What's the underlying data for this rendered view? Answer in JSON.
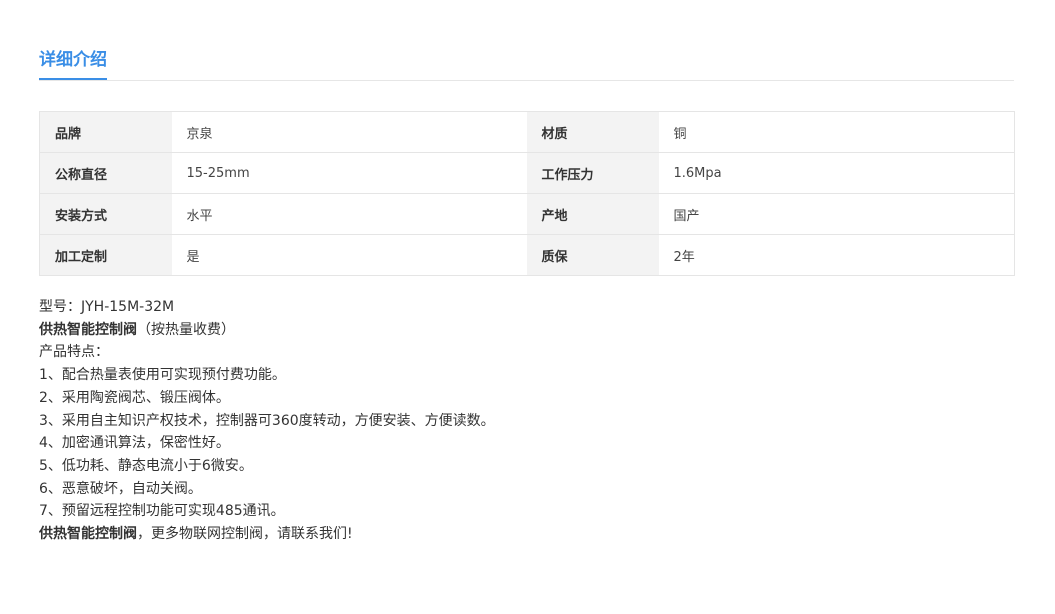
{
  "section": {
    "title": "详细介绍"
  },
  "specs": [
    {
      "k1": "品牌",
      "v1": "京泉",
      "k2": "材质",
      "v2": "铜"
    },
    {
      "k1": "公称直径",
      "v1": "15-25mm",
      "k2": "工作压力",
      "v2": "1.6Mpa"
    },
    {
      "k1": "安装方式",
      "v1": "水平",
      "k2": "产地",
      "v2": "国产"
    },
    {
      "k1": "加工定制",
      "v1": "是",
      "k2": "质保",
      "v2": "2年"
    }
  ],
  "description": {
    "model": "型号：JYH-15M-32M",
    "product_bold": "供热智能控制阀",
    "product_suffix": "（按热量收费）",
    "features_label": "产品特点：",
    "features": [
      "1、配合热量表使用可实现预付费功能。",
      "2、采用陶瓷阀芯、锻压阀体。",
      "3、采用自主知识产权技术，控制器可360度转动，方便安装、方便读数。",
      "4、加密通讯算法，保密性好。",
      "5、低功耗、静态电流小于6微安。",
      "6、恶意破坏，自动关阀。",
      "7、预留远程控制功能可实现485通讯。"
    ],
    "closing_bold": "供热智能控制阀",
    "closing_suffix": "，更多物联网控制阀，请联系我们!"
  }
}
